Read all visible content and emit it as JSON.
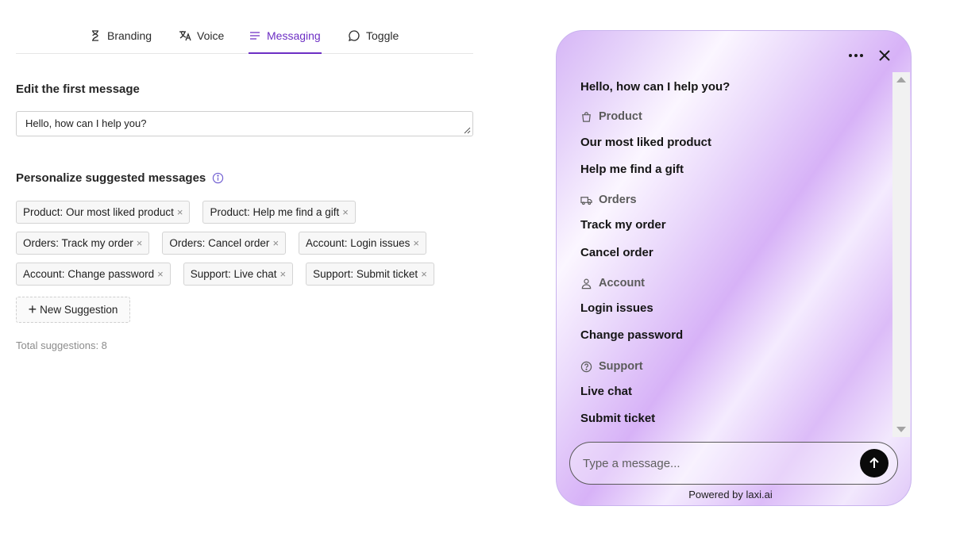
{
  "tabs": [
    {
      "label": "Branding",
      "icon": "hourglass-icon",
      "active": false
    },
    {
      "label": "Voice",
      "icon": "translate-icon",
      "active": false
    },
    {
      "label": "Messaging",
      "icon": "lines-icon",
      "active": true
    },
    {
      "label": "Toggle",
      "icon": "chat-bubble-icon",
      "active": false
    }
  ],
  "editor": {
    "first_message_title": "Edit the first message",
    "first_message_value": "Hello, how can I help you?",
    "suggest_title": "Personalize suggested messages",
    "chips": [
      [
        "Product: Our most liked product",
        "Product: Help me find a gift"
      ],
      [
        "Orders: Track my order",
        "Orders: Cancel order",
        "Account: Login issues"
      ],
      [
        "Account: Change password",
        "Support: Live chat",
        "Support: Submit ticket"
      ]
    ],
    "chip_remove": "×",
    "new_suggestion_plus": "+",
    "new_suggestion_label": "New Suggestion",
    "total_label": "Total suggestions: 8"
  },
  "widget": {
    "greeting": "Hello, how can I help you?",
    "categories": [
      {
        "name": "Product",
        "icon": "shopping-bag-icon",
        "items": [
          "Our most liked product",
          "Help me find a gift"
        ]
      },
      {
        "name": "Orders",
        "icon": "truck-icon",
        "items": [
          "Track my order",
          "Cancel order"
        ]
      },
      {
        "name": "Account",
        "icon": "user-icon",
        "items": [
          "Login issues",
          "Change password"
        ]
      },
      {
        "name": "Support",
        "icon": "help-circle-icon",
        "items": [
          "Live chat",
          "Submit ticket"
        ]
      }
    ],
    "input_placeholder": "Type a message...",
    "powered_by": "Powered by laxi.ai"
  },
  "colors": {
    "accent": "#6d2fc4",
    "send_button": "#0a0a0a"
  }
}
